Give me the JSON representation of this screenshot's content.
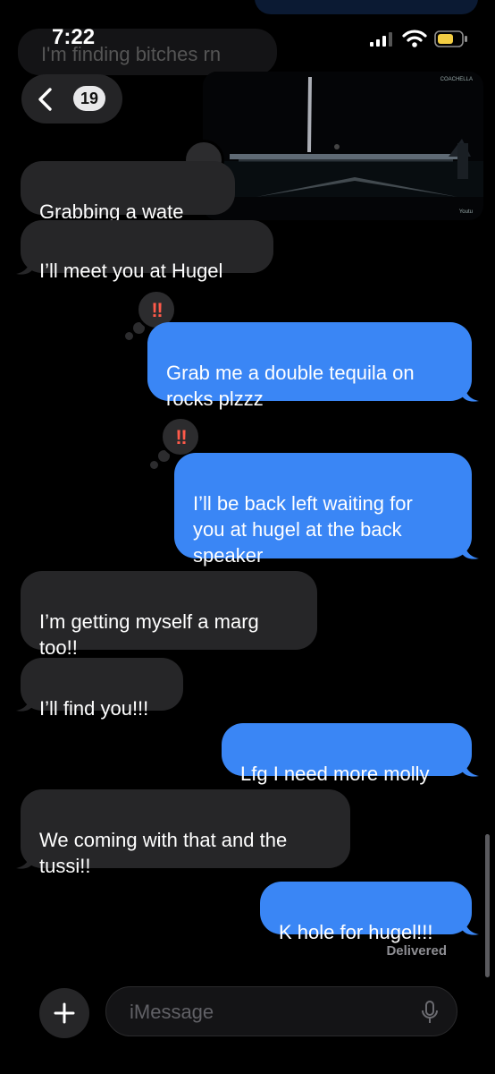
{
  "status_bar": {
    "time": "7:22"
  },
  "nav": {
    "back_badge": "19"
  },
  "ghost_message": "I'm finding bitches rn",
  "video": {
    "watermark_top": "COACHELLA",
    "watermark_bottom": "Youtu"
  },
  "messages": [
    {
      "from": "them",
      "text": "Grabbing a wate"
    },
    {
      "from": "them",
      "text": "I’ll meet you at Hugel"
    },
    {
      "from": "me",
      "text": "Grab me a double tequila on\nrocks plzzz",
      "reaction": "‼"
    },
    {
      "from": "me",
      "text": "I’ll be back left waiting for\nyou at hugel at the back\nspeaker",
      "reaction": "‼"
    },
    {
      "from": "them",
      "text": "I’m getting myself a marg\ntoo!!"
    },
    {
      "from": "them",
      "text": "I’ll find you!!!"
    },
    {
      "from": "me",
      "text": "Lfg I need more molly"
    },
    {
      "from": "them",
      "text": "We coming with that and the\ntussi!!"
    },
    {
      "from": "me",
      "text": "K hole for hugel!!!"
    }
  ],
  "delivered_label": "Delivered",
  "composer": {
    "placeholder": "iMessage"
  }
}
